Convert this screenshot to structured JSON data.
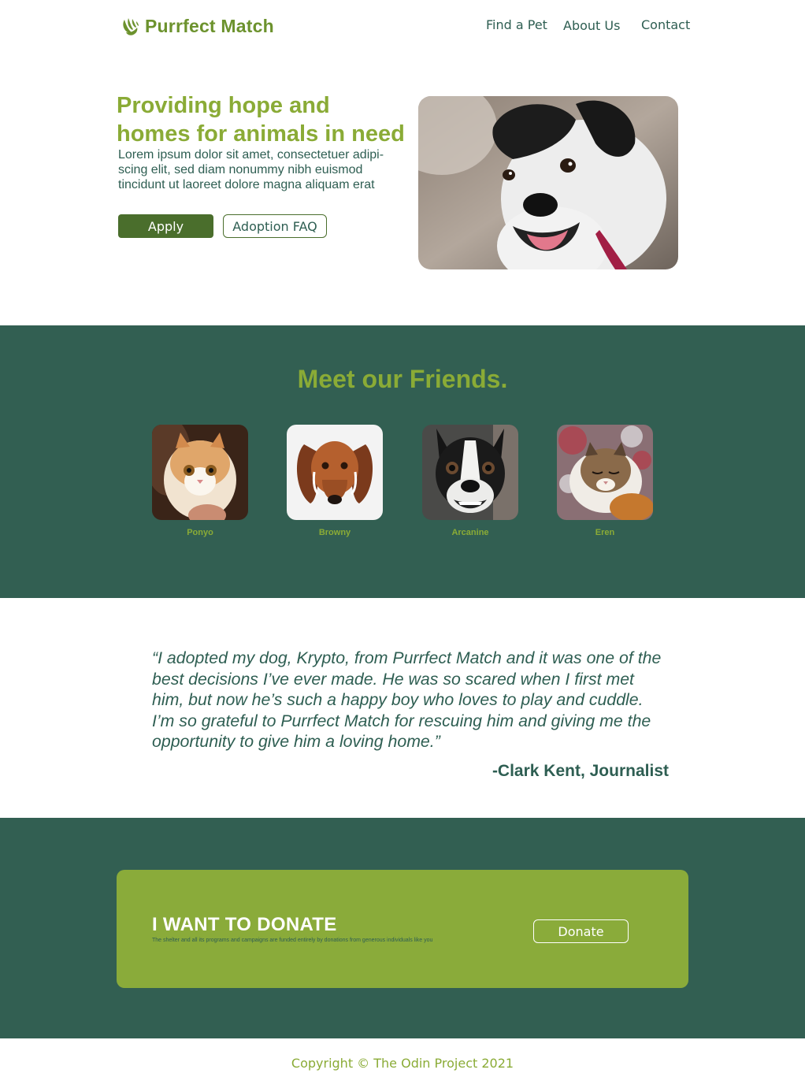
{
  "header": {
    "brand_name": "Purrfect Match",
    "brand_icon": "paw-icon",
    "nav": {
      "find_a_pet": "Find a Pet",
      "about_us": "About Us",
      "contact": "Contact"
    }
  },
  "hero": {
    "title": "Providing hope and homes for animals in need",
    "text": "Lorem ipsum dolor sit amet, consectetuer adipi-scing elit, sed diam nonummy nibh euismod tincidunt ut laoreet dolore magna aliquam erat",
    "apply_label": "Apply",
    "faq_label": "Adoption FAQ",
    "photo": "dog-photo"
  },
  "friends": {
    "title": "Meet our Friends.",
    "pets": [
      {
        "name": "Ponyo",
        "photo": "cat-photo"
      },
      {
        "name": "Browny",
        "photo": "dachshund-photo"
      },
      {
        "name": "Arcanine",
        "photo": "boston-terrier-photo"
      },
      {
        "name": "Eren",
        "photo": "sleeping-cat-photo"
      }
    ]
  },
  "testimonial": {
    "quote": "“I adopted my dog, Krypto, from Purrfect Match and it was one of the best decisions I’ve ever made. He was so scared when I first met him, but now he’s such a happy boy who loves to play and cuddle. I’m so grateful to Purrfect Match for rescuing him and giving me the opportunity to give him a loving home.”",
    "author": "-Clark Kent, Journalist"
  },
  "donate": {
    "title": "I WANT TO DONATE",
    "text": "The shelter and all its programs and campaigns are funded entirely by donations from generous individuals like you",
    "button_label": "Donate"
  },
  "footer": {
    "copyright": "Copyright © The Odin Project 2021"
  },
  "colors": {
    "brand_green": "#6c922d",
    "accent_green": "#8aab36",
    "dark_teal": "#325f52",
    "button_green": "#4a6e2c",
    "text_teal": "#2e5e52"
  }
}
